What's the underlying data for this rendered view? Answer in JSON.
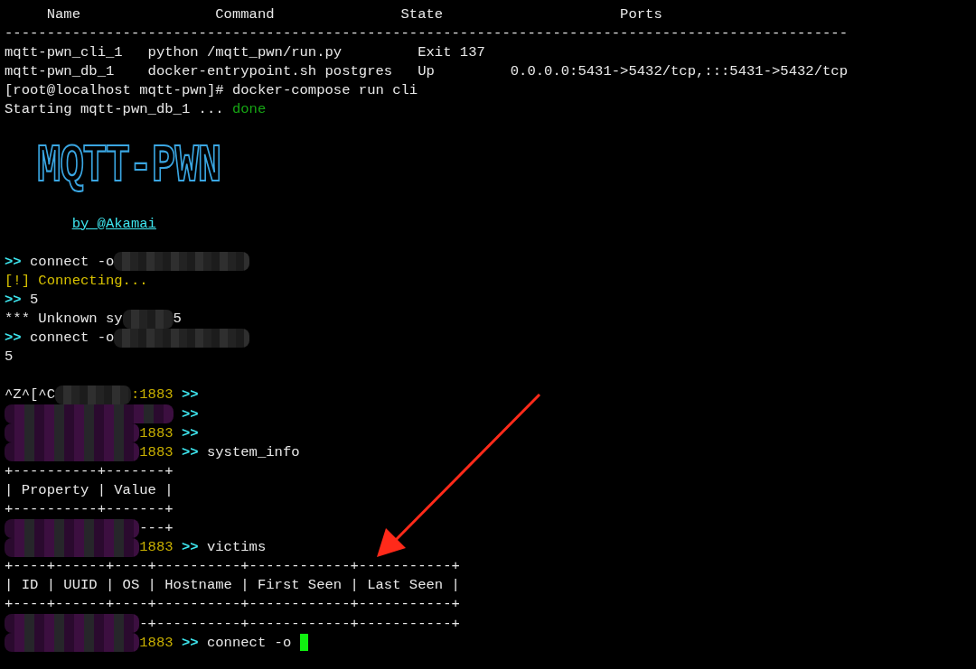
{
  "terminal": {
    "lines": [
      {
        "kind": "text",
        "segments": [
          {
            "kind": "plain",
            "text": "     Name                Command               State                     Ports"
          }
        ]
      },
      {
        "kind": "text",
        "segments": [
          {
            "kind": "plain",
            "text": "----------------------------------------------------------------------------------------------------"
          }
        ]
      },
      {
        "kind": "text",
        "segments": [
          {
            "kind": "plain",
            "text": "mqtt-pwn_cli_1   python /mqtt_pwn/run.py         Exit 137"
          }
        ]
      },
      {
        "kind": "text",
        "segments": [
          {
            "kind": "plain",
            "text": "mqtt-pwn_db_1    docker-entrypoint.sh postgres   Up         0.0.0.0:5431->5432/tcp,:::5431->5432/tcp"
          }
        ]
      },
      {
        "kind": "text",
        "segments": [
          {
            "kind": "plain",
            "text": "[root@localhost mqtt-pwn]# docker-compose run cli"
          }
        ]
      },
      {
        "kind": "text",
        "segments": [
          {
            "kind": "plain",
            "text": "Starting mqtt-pwn_db_1 ... "
          },
          {
            "kind": "ok",
            "text": "done"
          }
        ]
      },
      {
        "kind": "blank"
      },
      {
        "kind": "logo",
        "text": "MQTT-PWN"
      },
      {
        "kind": "blank"
      },
      {
        "kind": "text",
        "segments": [
          {
            "kind": "link",
            "text": "by @Akamai"
          }
        ]
      },
      {
        "kind": "blank"
      },
      {
        "kind": "text",
        "segments": [
          {
            "kind": "prompt",
            "text": ">> "
          },
          {
            "kind": "plain",
            "text": "connect -o"
          },
          {
            "kind": "redacted"
          }
        ]
      },
      {
        "kind": "text",
        "segments": [
          {
            "kind": "warn",
            "text": "[!] Connecting..."
          }
        ]
      },
      {
        "kind": "text",
        "segments": [
          {
            "kind": "prompt",
            "text": ">> "
          },
          {
            "kind": "plain",
            "text": "5"
          }
        ]
      },
      {
        "kind": "text",
        "segments": [
          {
            "kind": "plain",
            "text": "*** Unknown sy"
          },
          {
            "kind": "redacted"
          },
          {
            "kind": "plain",
            "text": "5"
          }
        ]
      },
      {
        "kind": "text",
        "segments": [
          {
            "kind": "prompt",
            "text": ">> "
          },
          {
            "kind": "plain",
            "text": "connect -o"
          },
          {
            "kind": "redacted"
          }
        ]
      },
      {
        "kind": "text",
        "segments": [
          {
            "kind": "plain",
            "text": "5"
          }
        ]
      },
      {
        "kind": "blank"
      },
      {
        "kind": "text",
        "segments": [
          {
            "kind": "plain",
            "text": "^Z^[^C"
          },
          {
            "kind": "redacted"
          },
          {
            "kind": "port",
            "text": ":1883"
          },
          {
            "kind": "prompt",
            "text": " >>"
          }
        ]
      },
      {
        "kind": "text",
        "segments": [
          {
            "kind": "redacted"
          },
          {
            "kind": "prompt",
            "text": " >>"
          }
        ]
      },
      {
        "kind": "text",
        "segments": [
          {
            "kind": "redacted"
          },
          {
            "kind": "port",
            "text": "1883"
          },
          {
            "kind": "prompt",
            "text": " >>"
          }
        ]
      },
      {
        "kind": "text",
        "segments": [
          {
            "kind": "redacted"
          },
          {
            "kind": "port",
            "text": "1883"
          },
          {
            "kind": "prompt",
            "text": " >> "
          },
          {
            "kind": "plain",
            "text": "system_info"
          }
        ]
      },
      {
        "kind": "text",
        "segments": [
          {
            "kind": "plain",
            "text": "+----------+-------+"
          }
        ]
      },
      {
        "kind": "text",
        "segments": [
          {
            "kind": "plain",
            "text": "| Property | Value |"
          }
        ]
      },
      {
        "kind": "text",
        "segments": [
          {
            "kind": "plain",
            "text": "+----------+-------+"
          }
        ]
      },
      {
        "kind": "text",
        "segments": [
          {
            "kind": "redacted"
          },
          {
            "kind": "plain",
            "text": "---+"
          }
        ]
      },
      {
        "kind": "text",
        "segments": [
          {
            "kind": "redacted"
          },
          {
            "kind": "port",
            "text": "1883"
          },
          {
            "kind": "prompt",
            "text": " >> "
          },
          {
            "kind": "plain",
            "text": "victims"
          }
        ]
      },
      {
        "kind": "text",
        "segments": [
          {
            "kind": "plain",
            "text": "+----+------+----+----------+------------+-----------+"
          }
        ]
      },
      {
        "kind": "text",
        "segments": [
          {
            "kind": "plain",
            "text": "| ID | UUID | OS | Hostname | First Seen | Last Seen |"
          }
        ]
      },
      {
        "kind": "text",
        "segments": [
          {
            "kind": "plain",
            "text": "+----+------+----+----------+------------+-----------+"
          }
        ]
      },
      {
        "kind": "text",
        "segments": [
          {
            "kind": "redacted"
          },
          {
            "kind": "plain",
            "text": "-+----------+------------+-----------+"
          }
        ]
      },
      {
        "kind": "text",
        "segments": [
          {
            "kind": "redacted"
          },
          {
            "kind": "port",
            "text": "1883"
          },
          {
            "kind": "prompt",
            "text": " >> "
          },
          {
            "kind": "plain",
            "text": "connect -o "
          },
          {
            "kind": "cursor"
          }
        ]
      }
    ]
  }
}
